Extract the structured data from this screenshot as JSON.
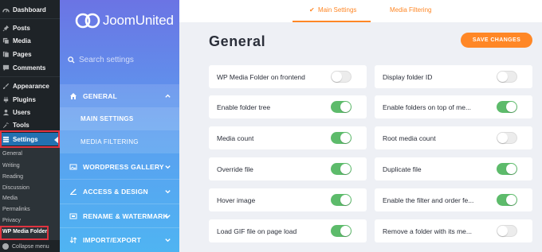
{
  "wp_menu": {
    "items": [
      {
        "label": "Dashboard",
        "icon": "dashboard-icon"
      },
      {
        "label": "Posts",
        "icon": "pin-icon"
      },
      {
        "label": "Media",
        "icon": "media-icon"
      },
      {
        "label": "Pages",
        "icon": "pages-icon"
      },
      {
        "label": "Comments",
        "icon": "comments-icon"
      },
      {
        "label": "Appearance",
        "icon": "brush-icon"
      },
      {
        "label": "Plugins",
        "icon": "plugin-icon"
      },
      {
        "label": "Users",
        "icon": "users-icon"
      },
      {
        "label": "Tools",
        "icon": "wrench-icon"
      },
      {
        "label": "Settings",
        "icon": "settings-icon"
      }
    ],
    "submenu": [
      "General",
      "Writing",
      "Reading",
      "Discussion",
      "Media",
      "Permalinks",
      "Privacy",
      "WP Media Folder"
    ],
    "collapse_label": "Collapse menu"
  },
  "plugin": {
    "brand": "JoomUnited",
    "search_placeholder": "Search settings",
    "nav": {
      "general": "GENERAL",
      "main_settings": "MAIN SETTINGS",
      "media_filtering": "MEDIA FILTERING",
      "wordpress_gallery": "WORDPRESS GALLERY",
      "access_design": "ACCESS & DESIGN",
      "rename_watermark": "RENAME & WATERMARK",
      "import_export": "IMPORT/EXPORT"
    }
  },
  "main": {
    "tabs": {
      "main_settings": "Main Settings",
      "main_check": "✔",
      "media_filtering": "Media Filtering"
    },
    "title": "General",
    "save_label": "SAVE CHANGES",
    "settings": [
      {
        "label": "WP Media Folder on frontend",
        "on": false
      },
      {
        "label": "Display folder ID",
        "on": false
      },
      {
        "label": "Enable folder tree",
        "on": true
      },
      {
        "label": "Enable folders on top of me...",
        "on": true
      },
      {
        "label": "Media count",
        "on": true
      },
      {
        "label": "Root media count",
        "on": false
      },
      {
        "label": "Override file",
        "on": true
      },
      {
        "label": "Duplicate file",
        "on": true
      },
      {
        "label": "Hover image",
        "on": true
      },
      {
        "label": "Enable the filter and order fe...",
        "on": true
      },
      {
        "label": "Load GIF file on page load",
        "on": true
      },
      {
        "label": "Remove a folder with its me...",
        "on": false
      }
    ]
  },
  "colors": {
    "accent": "#ff8726",
    "toggle_on": "#5dbb6b",
    "wp_active": "#2271b1",
    "highlight": "#e0333f"
  }
}
